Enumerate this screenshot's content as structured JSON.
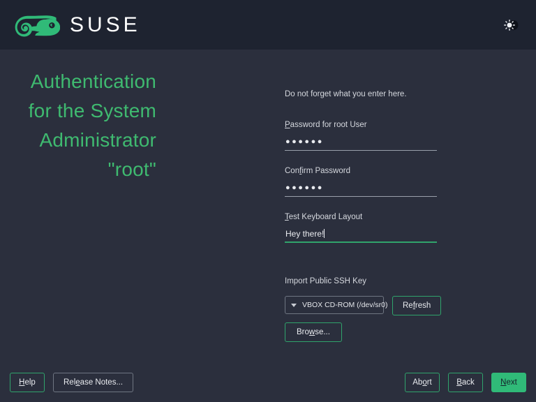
{
  "header": {
    "brand_name": "SUSE",
    "logo_icon": "suse-chameleon-logo",
    "theme_toggle_icon": "sun-moon-theme-icon"
  },
  "title_pane": {
    "lines": [
      "Authentication",
      "for the System",
      "Administrator",
      "\"root\""
    ],
    "full_title": "Authentication for the System Administrator \"root\""
  },
  "form": {
    "hint": "Do not forget what you enter here.",
    "fields": [
      {
        "label_prefix": "",
        "label_mnemonic": "P",
        "label_suffix": "assword for root User",
        "label": "Password for root User",
        "value": "●●●●●●",
        "type": "password",
        "focused": false
      },
      {
        "label_prefix": "Con",
        "label_mnemonic": "f",
        "label_suffix": "irm Password",
        "label": "Confirm Password",
        "value": "●●●●●●",
        "type": "password",
        "focused": false
      },
      {
        "label_prefix": "",
        "label_mnemonic": "T",
        "label_suffix": "est Keyboard Layout",
        "label": "Test Keyboard Layout",
        "value": "Hey there!",
        "type": "text",
        "focused": true
      }
    ],
    "ssh": {
      "label": "Import Public SSH Key",
      "device_selected": "VBOX CD-ROM (/dev/sr0)",
      "refresh": {
        "prefix": "Re",
        "mnemonic": "f",
        "suffix": "resh",
        "label": "Refresh"
      },
      "browse": {
        "prefix": "Bro",
        "mnemonic": "w",
        "suffix": "se...",
        "label": "Browse..."
      }
    }
  },
  "footer": {
    "help": {
      "prefix": "",
      "mnemonic": "H",
      "suffix": "elp",
      "label": "Help"
    },
    "release": {
      "prefix": "Rel",
      "mnemonic": "e",
      "suffix": "ase Notes...",
      "label": "Release Notes..."
    },
    "abort": {
      "prefix": "Ab",
      "mnemonic": "o",
      "suffix": "rt",
      "label": "Abort"
    },
    "back": {
      "prefix": "",
      "mnemonic": "B",
      "suffix": "ack",
      "label": "Back"
    },
    "next": {
      "prefix": "",
      "mnemonic": "N",
      "suffix": "ext",
      "label": "Next"
    }
  },
  "colors": {
    "header_bg": "#1e2330",
    "body_bg": "#2b2f3d",
    "accent_green": "#30ba78",
    "title_green": "#3fba70",
    "border_gray": "#6f7682",
    "text_light": "#e9ebef",
    "text_muted": "#d5d8de"
  }
}
